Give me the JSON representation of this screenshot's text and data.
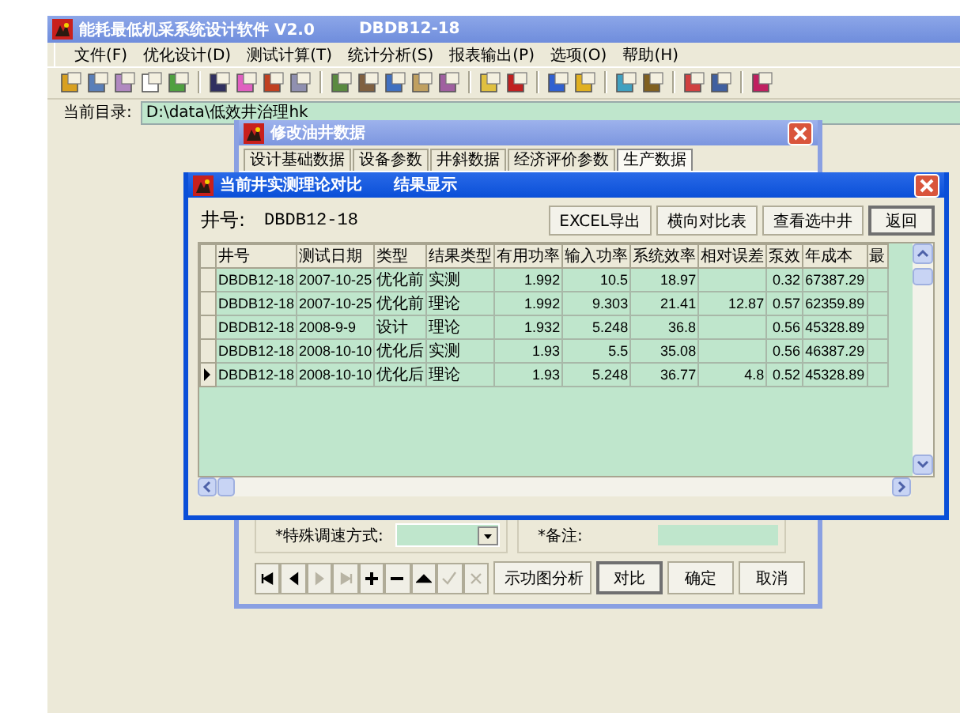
{
  "main_window": {
    "title": "能耗最低机采系统设计软件 V2.0",
    "title_well": "DBDB12-18"
  },
  "menu": [
    "文件(F)",
    "优化设计(D)",
    "测试计算(T)",
    "统计分析(S)",
    "报表输出(P)",
    "选项(O)",
    "帮助(H)"
  ],
  "directory": {
    "label": "当前目录:",
    "value": "D:\\data\\低效井治理hk"
  },
  "edit_dialog": {
    "title": "修改油井数据",
    "tabs": [
      {
        "label": "设计基础数据",
        "selected": false
      },
      {
        "label": "设备参数",
        "selected": false
      },
      {
        "label": "井斜数据",
        "selected": false
      },
      {
        "label": "经济评价参数",
        "selected": false
      },
      {
        "label": "生产数据",
        "selected": true
      }
    ],
    "special_speed_label": "*特殊调速方式:",
    "remark_label": "*备注:",
    "navigator": [
      {
        "kind": "first",
        "disabled": false
      },
      {
        "kind": "prior",
        "disabled": false
      },
      {
        "kind": "next",
        "disabled": true
      },
      {
        "kind": "last",
        "disabled": true
      },
      {
        "kind": "insert",
        "disabled": false
      },
      {
        "kind": "delete",
        "disabled": false
      },
      {
        "kind": "edit",
        "disabled": false
      },
      {
        "kind": "post",
        "disabled": true
      },
      {
        "kind": "cancel",
        "disabled": true
      }
    ],
    "buttons": [
      {
        "label": "示功图分析",
        "default": false
      },
      {
        "label": "对比",
        "default": true
      },
      {
        "label": "确定",
        "default": false
      },
      {
        "label": "取消",
        "default": false
      }
    ]
  },
  "compare_dialog": {
    "title": "当前井实测理论对比",
    "subtitle": "结果显示",
    "well_label": "井号:",
    "well_value": "DBDB12-18",
    "buttons": [
      {
        "label": "EXCEL导出",
        "default": false
      },
      {
        "label": "横向对比表",
        "default": false
      },
      {
        "label": "查看选中井",
        "default": false
      },
      {
        "label": "返回",
        "default": true
      }
    ],
    "table": {
      "columns": [
        "井号",
        "测试日期",
        "类型",
        "结果类型",
        "有用功率",
        "输入功率",
        "系统效率",
        "相对误差",
        "泵效",
        "年成本",
        "最"
      ],
      "rows": [
        {
          "current": false,
          "cells": [
            "DBDB12-18",
            "2007-10-25",
            "优化前",
            "实测",
            "1.992",
            "10.5",
            "18.97",
            "",
            "0.32",
            "67387.29"
          ]
        },
        {
          "current": false,
          "cells": [
            "DBDB12-18",
            "2007-10-25",
            "优化前",
            "理论",
            "1.992",
            "9.303",
            "21.41",
            "12.87",
            "0.57",
            "62359.89"
          ]
        },
        {
          "current": false,
          "cells": [
            "DBDB12-18",
            "2008-9-9",
            "设计",
            "理论",
            "1.932",
            "5.248",
            "36.8",
            "",
            "0.56",
            "45328.89"
          ]
        },
        {
          "current": false,
          "cells": [
            "DBDB12-18",
            "2008-10-10",
            "优化后",
            "实测",
            "1.93",
            "5.5",
            "35.08",
            "",
            "0.56",
            "46387.29"
          ]
        },
        {
          "current": true,
          "cells": [
            "DBDB12-18",
            "2008-10-10",
            "优化后",
            "理论",
            "1.93",
            "5.248",
            "36.77",
            "4.8",
            "0.52",
            "45328.89"
          ]
        }
      ]
    }
  }
}
